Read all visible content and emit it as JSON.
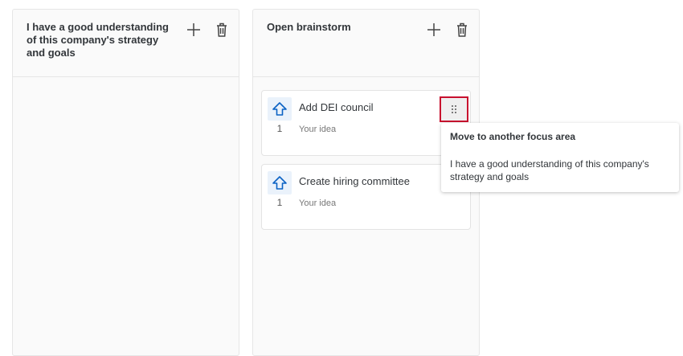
{
  "columns": [
    {
      "title": "I have a good understanding of this company's strategy and goals",
      "cards": []
    },
    {
      "title": "Open brainstorm",
      "cards": [
        {
          "title": "Add DEI council",
          "votes": "1",
          "subtitle": "Your idea"
        },
        {
          "title": "Create hiring committee",
          "votes": "1",
          "subtitle": "Your idea"
        }
      ]
    }
  ],
  "tooltip": {
    "title": "Move to another focus area",
    "item": "I have a good understanding of this company's strategy and goals"
  },
  "colors": {
    "accent": "#0b62c4",
    "highlight": "#c8102e"
  }
}
